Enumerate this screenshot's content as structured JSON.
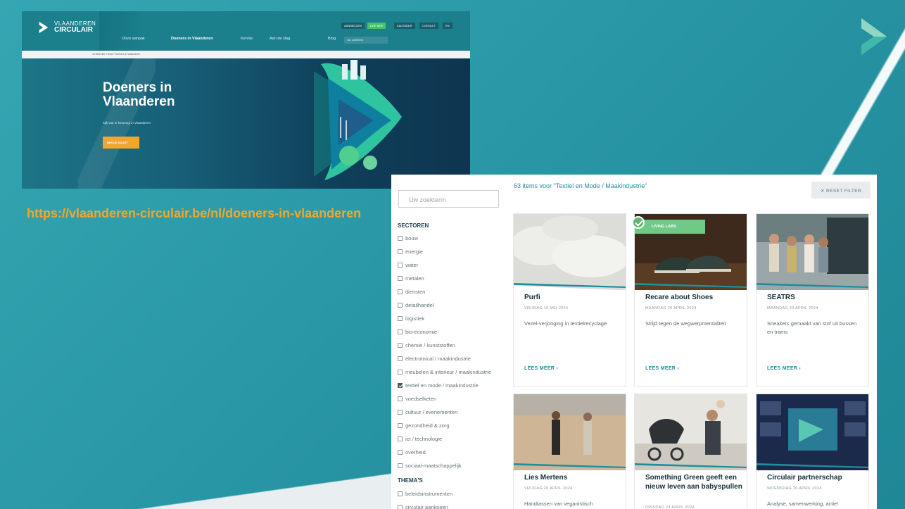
{
  "slide": {
    "url_text": "https://vlaanderen-circulair.be/nl/doeners-in-vlaanderen"
  },
  "site": {
    "brand_top": "VLAANDEREN",
    "brand_bottom": "CIRCULAIR",
    "menu": [
      "Onze aanpak",
      "Doeners in Vlaanderen",
      "Kennis",
      "Aan de slag",
      "Blog"
    ],
    "utility": [
      "AANMELDEN",
      "DOE MEE",
      "KALENDER",
      "CONTACT",
      "EN"
    ],
    "search_placeholder": "Uw zoekterm",
    "breadcrumb": "Je bent hier:  Home  /  Doeners in Vlaanderen",
    "hero_title_line1": "Doeners in",
    "hero_title_line2": "Vlaanderen",
    "hero_subtitle": "Kijk wat er beweegt in Vlaanderen",
    "hero_button": "BEKIJK KAART"
  },
  "listing": {
    "search_placeholder": "Uw zoekterm",
    "results_count": "63 items voor \"Textiel en Mode / Maakindustrie\"",
    "reset_label": "✕  RESET FILTER",
    "sectors_heading": "SECTOREN",
    "sectors": [
      {
        "label": "bouw",
        "checked": false
      },
      {
        "label": "energie",
        "checked": false
      },
      {
        "label": "water",
        "checked": false
      },
      {
        "label": "metalen",
        "checked": false
      },
      {
        "label": "diensten",
        "checked": false
      },
      {
        "label": "detailhandel",
        "checked": false
      },
      {
        "label": "logistiek",
        "checked": false
      },
      {
        "label": "bio-economie",
        "checked": false
      },
      {
        "label": "chemie / kunststoffen",
        "checked": false
      },
      {
        "label": "electrotnical / maakindustrie",
        "checked": false
      },
      {
        "label": "meubelen & interieur / maakindustrie",
        "checked": false
      },
      {
        "label": "textiel en mode / maakindustrie",
        "checked": true
      },
      {
        "label": "voedselketen",
        "checked": false
      },
      {
        "label": "cultuur / evenementen",
        "checked": false
      },
      {
        "label": "gezondheid & zorg",
        "checked": false
      },
      {
        "label": "ict / technologie",
        "checked": false
      },
      {
        "label": "overheid",
        "checked": false
      },
      {
        "label": "sociaal-maatschappelijk",
        "checked": false
      }
    ],
    "themes_heading": "THEMA'S",
    "themes": [
      {
        "label": "beleidsinstrumenten",
        "checked": false
      },
      {
        "label": "circulair aankopen",
        "checked": false
      }
    ],
    "cards": [
      {
        "title": "Purfi",
        "date": "VRIJDAG 10 MEI 2024",
        "desc": "Vezel-verjonging in textielrecyclage",
        "more": "LEES MEER ›",
        "badge": ""
      },
      {
        "title": "Recare about Shoes",
        "date": "MAANDAG 29 APRIL 2024",
        "desc": "Strijd tegen de wegwerpmentaliteit",
        "more": "LEES MEER ›",
        "badge": "LIVING LABS"
      },
      {
        "title": "SEATRS",
        "date": "MAANDAG 29 APRIL 2024",
        "desc": "Sneakers gemaakt van stof uit bussen en trams",
        "more": "LEES MEER ›",
        "badge": ""
      },
      {
        "title": "Lies Mertens",
        "date": "VRIJDAG 26 APRIL 2024",
        "desc": "Handtassen van veganistisch",
        "more": "",
        "badge": ""
      },
      {
        "title": "Something Green geeft een nieuw leven aan babyspullen",
        "date": "DINSDAG 23 APRIL 2024",
        "desc": "",
        "more": "",
        "badge": ""
      },
      {
        "title": "Circulair partnerschap",
        "date": "WOENSDAG 10 APRIL 2024",
        "desc": "Analyse, samenwerking, actie!",
        "more": "",
        "badge": ""
      }
    ]
  },
  "colors": {
    "accent": "#1f8e9c",
    "orange": "#f4a62a",
    "slide_bg": "#2a99a8"
  }
}
